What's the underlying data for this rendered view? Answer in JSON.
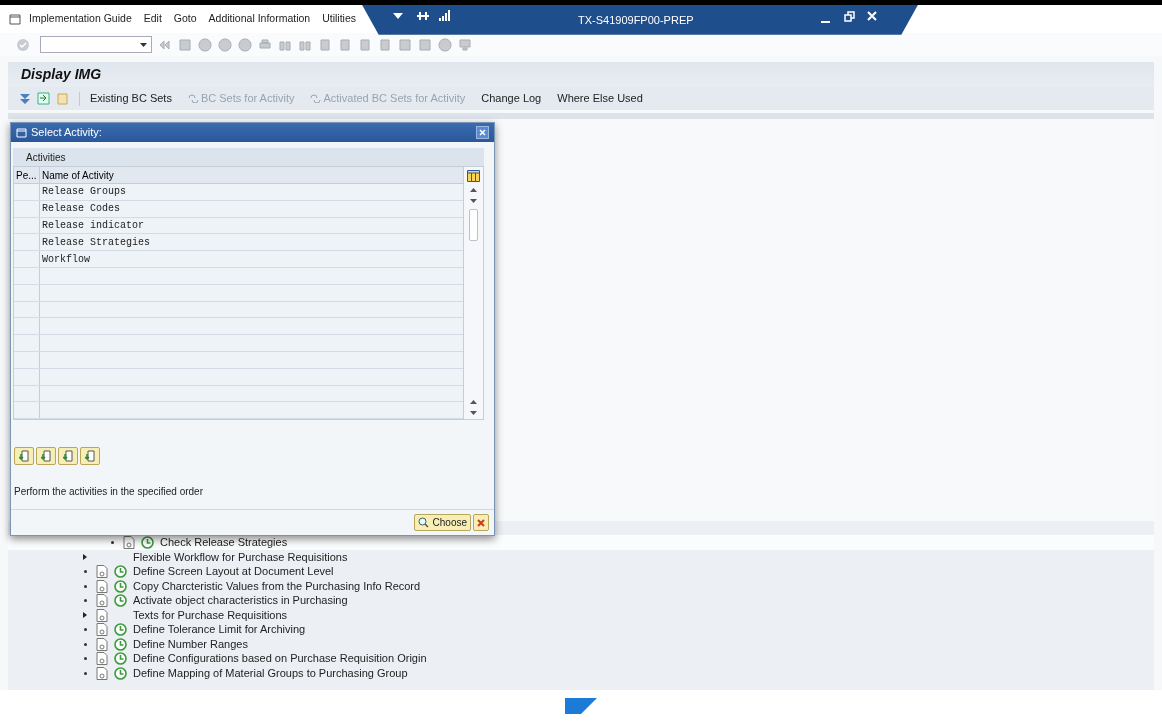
{
  "menu": [
    "Implementation Guide",
    "Edit",
    "Goto",
    "Additional Information",
    "Utilities"
  ],
  "window": {
    "title": "TX-S41909FP00-PREP"
  },
  "screen_title": "Display IMG",
  "app_toolbar": [
    {
      "label": "Existing BC Sets",
      "disabled": false,
      "bc_icon": false
    },
    {
      "label": "BC Sets for Activity",
      "disabled": true,
      "bc_icon": true
    },
    {
      "label": "Activated BC Sets for Activity",
      "disabled": true,
      "bc_icon": true
    },
    {
      "label": "Change Log",
      "disabled": false,
      "bc_icon": false
    },
    {
      "label": "Where Else Used",
      "disabled": false,
      "bc_icon": false
    }
  ],
  "dialog": {
    "title": "Select Activity:",
    "section": "Activities",
    "columns": [
      "Pe...",
      "Name of Activity"
    ],
    "rows": [
      {
        "name": "Release Groups"
      },
      {
        "name": "Release Codes"
      },
      {
        "name": "Release indicator"
      },
      {
        "name": "Release Strategies"
      },
      {
        "name": "Workflow"
      }
    ],
    "hint": "Perform the activities in the specified order",
    "choose": "Choose"
  },
  "tree": [
    {
      "kind": "covered",
      "children": [
        {
          "kind": "activity",
          "label": "Check Release Strategies"
        }
      ]
    },
    {
      "kind": "node",
      "label": "Flexible Workflow for Purchase Requisitions"
    },
    {
      "kind": "activity",
      "label": "Define Screen Layout at Document Level"
    },
    {
      "kind": "activity",
      "label": "Copy Charcteristic Values from the Purchasing Info Record"
    },
    {
      "kind": "activity",
      "label": "Activate object characteristics in Purchasing"
    },
    {
      "kind": "node_doc",
      "label": "Texts for Purchase Requisitions"
    },
    {
      "kind": "activity",
      "label": "Define Tolerance Limit for Archiving"
    },
    {
      "kind": "activity",
      "label": "Define Number Ranges"
    },
    {
      "kind": "activity",
      "label": "Define Configurations based on Purchase Requisition Origin"
    },
    {
      "kind": "activity",
      "label": "Define Mapping of Material Groups to Purchasing Group"
    }
  ]
}
